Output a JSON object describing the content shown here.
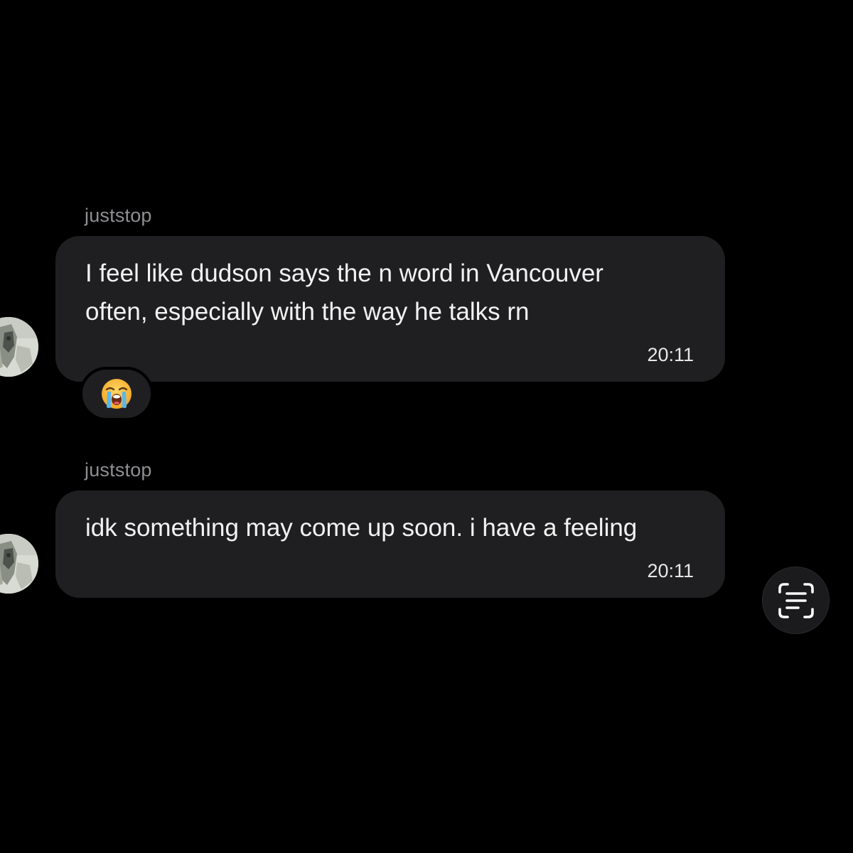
{
  "messages": [
    {
      "sender": "juststop",
      "text": "I feel like dudson says the n word in Vancouver often, especially with the way he talks rn",
      "time": "20:11",
      "reaction": "😭"
    },
    {
      "sender": "juststop",
      "text": "idk something may come up soon. i have a feeling",
      "time": "20:11"
    }
  ],
  "icons": {
    "reaction": "loudly-crying-face-emoji",
    "scan": "live-text-scan-icon",
    "avatar": "profile-avatar"
  },
  "colors": {
    "background": "#000000",
    "bubble": "#1f1f21",
    "sender_text": "#8e8e93",
    "message_text": "#f2f2f2"
  }
}
